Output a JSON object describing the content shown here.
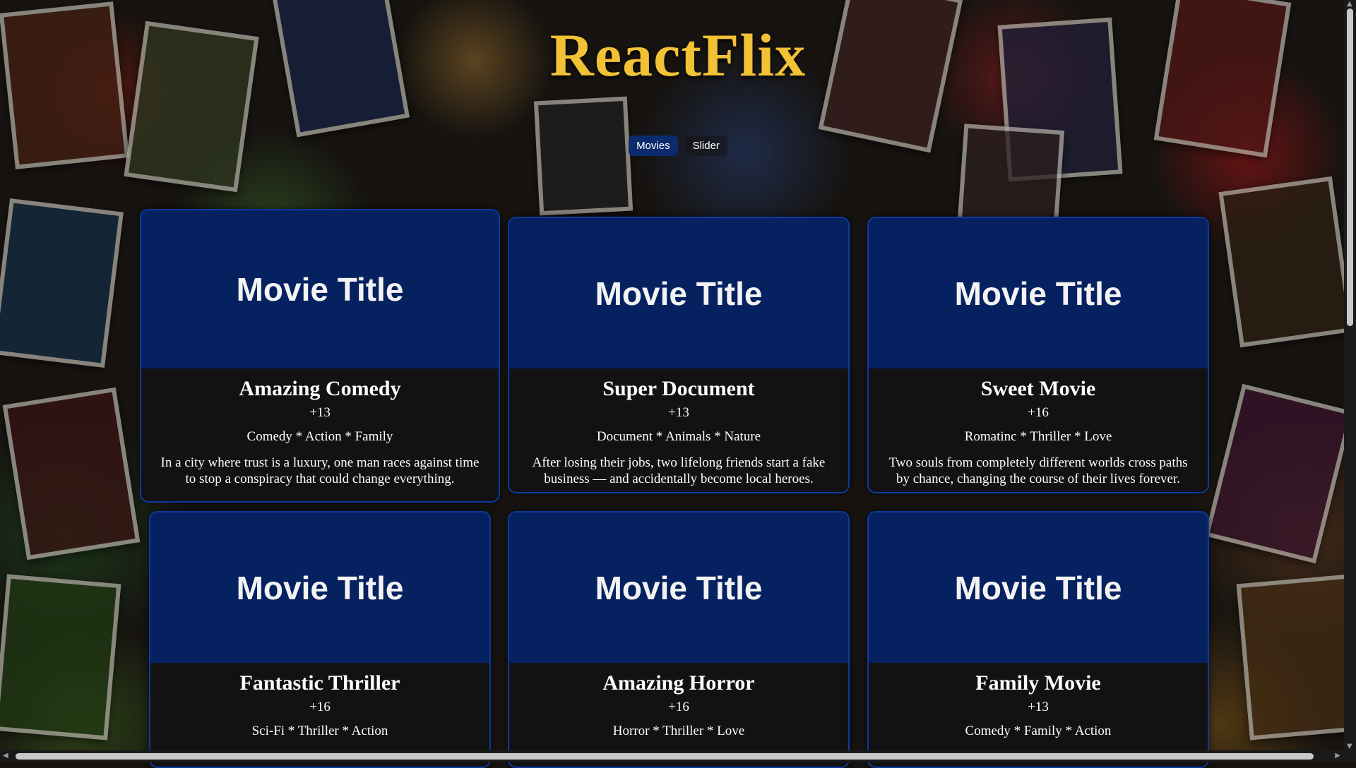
{
  "app": {
    "logo": "ReactFlix"
  },
  "nav": {
    "items": [
      {
        "label": "Movies"
      },
      {
        "label": "Slider"
      }
    ]
  },
  "movies": [
    {
      "image_text": "Movie Title",
      "title": "Amazing Comedy",
      "rating": "+13",
      "genres": "Comedy * Action * Family",
      "description": "In a city where trust is a luxury, one man races against time to stop a conspiracy that could change everything."
    },
    {
      "image_text": "Movie Title",
      "title": "Super Document",
      "rating": "+13",
      "genres": "Document * Animals * Nature",
      "description": "After losing their jobs, two lifelong friends start a fake business — and accidentally become local heroes."
    },
    {
      "image_text": "Movie Title",
      "title": "Sweet Movie",
      "rating": "+16",
      "genres": "Romatinc * Thriller * Love",
      "description": "Two souls from completely different worlds cross paths by chance, changing the course of their lives forever."
    },
    {
      "image_text": "Movie Title",
      "title": "Fantastic Thriller",
      "rating": "+16",
      "genres": "Sci-Fi * Thriller * Action",
      "description": ""
    },
    {
      "image_text": "Movie Title",
      "title": "Amazing Horror",
      "rating": "+16",
      "genres": "Horror * Thriller * Love",
      "description": ""
    },
    {
      "image_text": "Movie Title",
      "title": "Family Movie",
      "rating": "+13",
      "genres": "Comedy * Family * Action",
      "description": ""
    }
  ],
  "colors": {
    "logo": "#f2c236",
    "card_image_bg": "#06215f",
    "card_border": "#0d3a9e",
    "nav_active": "#0c2a6e"
  },
  "icons": {
    "scroll_up": "arrow-up-icon",
    "scroll_down": "arrow-down-icon",
    "scroll_left": "arrow-left-icon",
    "scroll_right": "arrow-right-icon"
  }
}
